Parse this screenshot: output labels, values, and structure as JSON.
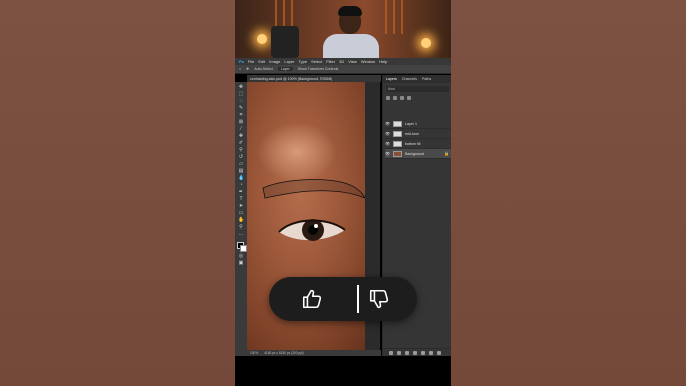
{
  "video": {
    "webcam_label": "presenter webcam"
  },
  "photoshop": {
    "menu": [
      "File",
      "Edit",
      "Image",
      "Layer",
      "Type",
      "Select",
      "Filter",
      "3D",
      "View",
      "Window",
      "Help"
    ],
    "options": {
      "auto_select_label": "Auto-Select",
      "layer_dropdown": "Layer",
      "transform_controls_label": "Show Transform Controls"
    },
    "document_tab": "contrasting-skin.psd @ 100% (Background, RGB/8)",
    "status": {
      "zoom": "100%",
      "doc_info": "4160 px x 6240 px (300 ppi)"
    },
    "panel": {
      "tabs": [
        "Layers",
        "Channels",
        "Paths"
      ],
      "active_tab": "Layers",
      "search_kind": "Kind",
      "layers": [
        {
          "name": "Layer 1",
          "selected": false,
          "photo": false
        },
        {
          "name": "mid-tone",
          "selected": false,
          "photo": false
        },
        {
          "name": "bottom fill",
          "selected": false,
          "photo": false
        },
        {
          "name": "Background",
          "selected": true,
          "photo": true
        }
      ]
    }
  },
  "reactions": {
    "like": "like",
    "dislike": "dislike"
  },
  "colors": {
    "background": "#7a4e3e",
    "ps_dark": "#353535",
    "reaction_bg": "#1d1d1d"
  }
}
